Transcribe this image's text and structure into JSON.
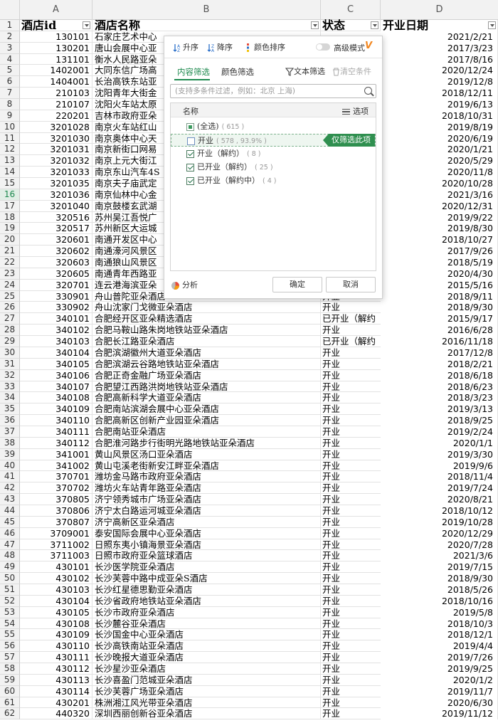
{
  "columns": [
    "A",
    "B",
    "C",
    "D"
  ],
  "header": {
    "id": "酒店id",
    "name": "酒店名称",
    "status": "状态",
    "date": "开业日期"
  },
  "highlight_row": 16,
  "rows": [
    [
      "130101",
      "石家庄艺术中心",
      "",
      "2021/2/21"
    ],
    [
      "130201",
      "唐山会展中心亚",
      "",
      "2017/3/23"
    ],
    [
      "131101",
      "衡水人民路亚朵",
      "",
      "2017/8/16"
    ],
    [
      "1402001",
      "大同东信广场高",
      "",
      "2020/12/24"
    ],
    [
      "1404001",
      "长治高铁东站亚",
      "",
      "2019/12/8"
    ],
    [
      "210103",
      "沈阳青年大街金",
      "",
      "2018/12/11"
    ],
    [
      "210107",
      "沈阳火车站太原",
      "",
      "2019/6/13"
    ],
    [
      "220201",
      "吉林市政府亚朵",
      "",
      "2018/10/31"
    ],
    [
      "3201028",
      "南京火车站红山",
      "",
      "2019/8/19"
    ],
    [
      "3201030",
      "南京奥体中心天",
      "",
      "2020/6/19"
    ],
    [
      "3201031",
      "南京新街口网易",
      "",
      "2020/1/21"
    ],
    [
      "3201032",
      "南京上元大街江",
      "",
      "2020/5/29"
    ],
    [
      "3201033",
      "南京东山汽车4S",
      "",
      "2020/11/8"
    ],
    [
      "3201035",
      "南京夫子庙武定",
      "",
      "2020/10/28"
    ],
    [
      "3201036",
      "南京仙林中心金",
      "",
      "2021/3/16"
    ],
    [
      "3201040",
      "南京鼓楼玄武湖",
      "",
      "2020/12/31"
    ],
    [
      "320516",
      "苏州吴江吾悦广",
      "",
      "2019/9/22"
    ],
    [
      "320517",
      "苏州新区大运城",
      "",
      "2019/8/30"
    ],
    [
      "320601",
      "南通开发区中心",
      "",
      "2018/10/27"
    ],
    [
      "320602",
      "南通濠河风景区",
      "",
      "2017/9/26"
    ],
    [
      "320603",
      "南通狼山风景区",
      "",
      "2018/5/19"
    ],
    [
      "320605",
      "南通青年西路亚",
      "",
      "2020/4/30"
    ],
    [
      "320701",
      "连云港海滨亚朵",
      "",
      "2015/5/16"
    ],
    [
      "330901",
      "舟山普陀亚朵酒店",
      "开业",
      "2018/9/11"
    ],
    [
      "330902",
      "舟山沈家门戈微亚朵酒店",
      "开业",
      "2018/9/30"
    ],
    [
      "340101",
      "合肥经开区亚朵精选酒店",
      "已开业（解约",
      "2015/9/17"
    ],
    [
      "340102",
      "合肥马鞍山路朱岗地铁站亚朵酒店",
      "开业",
      "2016/6/28"
    ],
    [
      "340103",
      "合肥长江路亚朵酒店",
      "已开业（解约",
      "2016/11/18"
    ],
    [
      "340104",
      "合肥滨湖徽州大道亚朵酒店",
      "开业",
      "2017/12/8"
    ],
    [
      "340105",
      "合肥滨湖云谷路地铁站亚朵酒店",
      "开业",
      "2018/2/21"
    ],
    [
      "340106",
      "合肥正奇金融广场亚朵酒店",
      "开业",
      "2018/6/18"
    ],
    [
      "340107",
      "合肥望江西路洪岗地铁站亚朵酒店",
      "开业",
      "2018/6/23"
    ],
    [
      "340108",
      "合肥高新科学大道亚朵酒店",
      "开业",
      "2018/3/23"
    ],
    [
      "340109",
      "合肥南站滨湖会展中心亚朵酒店",
      "开业",
      "2019/3/13"
    ],
    [
      "340110",
      "合肥高新区创新产业园亚朵酒店",
      "开业",
      "2018/9/25"
    ],
    [
      "340111",
      "合肥南站亚朵酒店",
      "开业",
      "2019/2/24"
    ],
    [
      "340112",
      "合肥淮河路步行街明光路地铁站亚朵酒店",
      "开业",
      "2020/1/1"
    ],
    [
      "341001",
      "黄山风景区汤口亚朵酒店",
      "开业",
      "2019/3/30"
    ],
    [
      "341002",
      "黄山屯溪老街新安江畔亚朵酒店",
      "开业",
      "2019/9/6"
    ],
    [
      "370701",
      "潍坊金马路市政府亚朵酒店",
      "开业",
      "2018/11/4"
    ],
    [
      "370702",
      "潍坊火车站青年路亚朵酒店",
      "开业",
      "2019/7/24"
    ],
    [
      "370805",
      "济宁领秀城市广场亚朵酒店",
      "开业",
      "2020/8/21"
    ],
    [
      "370806",
      "济宁太白路运河城亚朵酒店",
      "开业",
      "2018/10/12"
    ],
    [
      "370807",
      "济宁高新区亚朵酒店",
      "开业",
      "2019/10/28"
    ],
    [
      "3709001",
      "泰安国际会展中心亚朵酒店",
      "开业",
      "2020/12/29"
    ],
    [
      "3711002",
      "日照东夷小镇海景亚朵酒店",
      "开业",
      "2020/7/28"
    ],
    [
      "3711003",
      "日照市政府亚朵篮球酒店",
      "开业",
      "2021/3/6"
    ],
    [
      "430101",
      "长沙医学院亚朵酒店",
      "开业",
      "2019/7/15"
    ],
    [
      "430102",
      "长沙芙蓉中路中成亚朵S酒店",
      "开业",
      "2018/9/30"
    ],
    [
      "430103",
      "长沙红星德思勤亚朵酒店",
      "开业",
      "2018/5/26"
    ],
    [
      "430104",
      "长沙省政府地铁站亚朵酒店",
      "开业",
      "2018/10/16"
    ],
    [
      "430105",
      "长沙市政府亚朵酒店",
      "开业",
      "2019/5/8"
    ],
    [
      "430108",
      "长沙麓谷亚朵酒店",
      "开业",
      "2018/10/3"
    ],
    [
      "430109",
      "长沙国金中心亚朵酒店",
      "开业",
      "2018/12/1"
    ],
    [
      "430110",
      "长沙高铁南站亚朵酒店",
      "开业",
      "2019/4/4"
    ],
    [
      "430111",
      "长沙晚报大道亚朵酒店",
      "开业",
      "2019/7/26"
    ],
    [
      "430112",
      "长沙星沙亚朵酒店",
      "开业",
      "2019/9/25"
    ],
    [
      "430113",
      "长沙喜盈门范城亚朵酒店",
      "开业",
      "2020/1/2"
    ],
    [
      "430114",
      "长沙芙蓉广场亚朵酒店",
      "开业",
      "2019/11/7"
    ],
    [
      "430201",
      "株洲湘江风光带亚朵酒店",
      "开业",
      "2020/6/30"
    ],
    [
      "440320",
      "深圳西丽创新谷亚朵酒店",
      "开业",
      "2019/11/12"
    ]
  ],
  "popup": {
    "sort_asc": "升序",
    "sort_desc": "降序",
    "color_sort": "颜色排序",
    "advanced_mode": "高级模式",
    "vip_badge": "V",
    "tab_content": "内容筛选",
    "tab_color": "颜色筛选",
    "text_filter": "文本筛选",
    "clear_conditions": "清空条件",
    "search_placeholder": "(支持多条件过滤，例如：北京 上海)",
    "list_header_name": "名称",
    "list_header_options": "选项",
    "items": [
      {
        "label": "(全选)",
        "count": "( 615 )",
        "state": "partial"
      },
      {
        "label": "开业",
        "count": "( 578 , 93.9% )",
        "state": "unchecked"
      },
      {
        "label": "开业（解约）",
        "count": "( 8 )",
        "state": "checked"
      },
      {
        "label": "已开业（解约）",
        "count": "( 25 )",
        "state": "checked"
      },
      {
        "label": "已开业（解约中）",
        "count": "( 4 )",
        "state": "checked"
      }
    ],
    "only_filter_this": "仅筛选此项",
    "analysis": "分析",
    "ok": "确定",
    "cancel": "取消"
  }
}
